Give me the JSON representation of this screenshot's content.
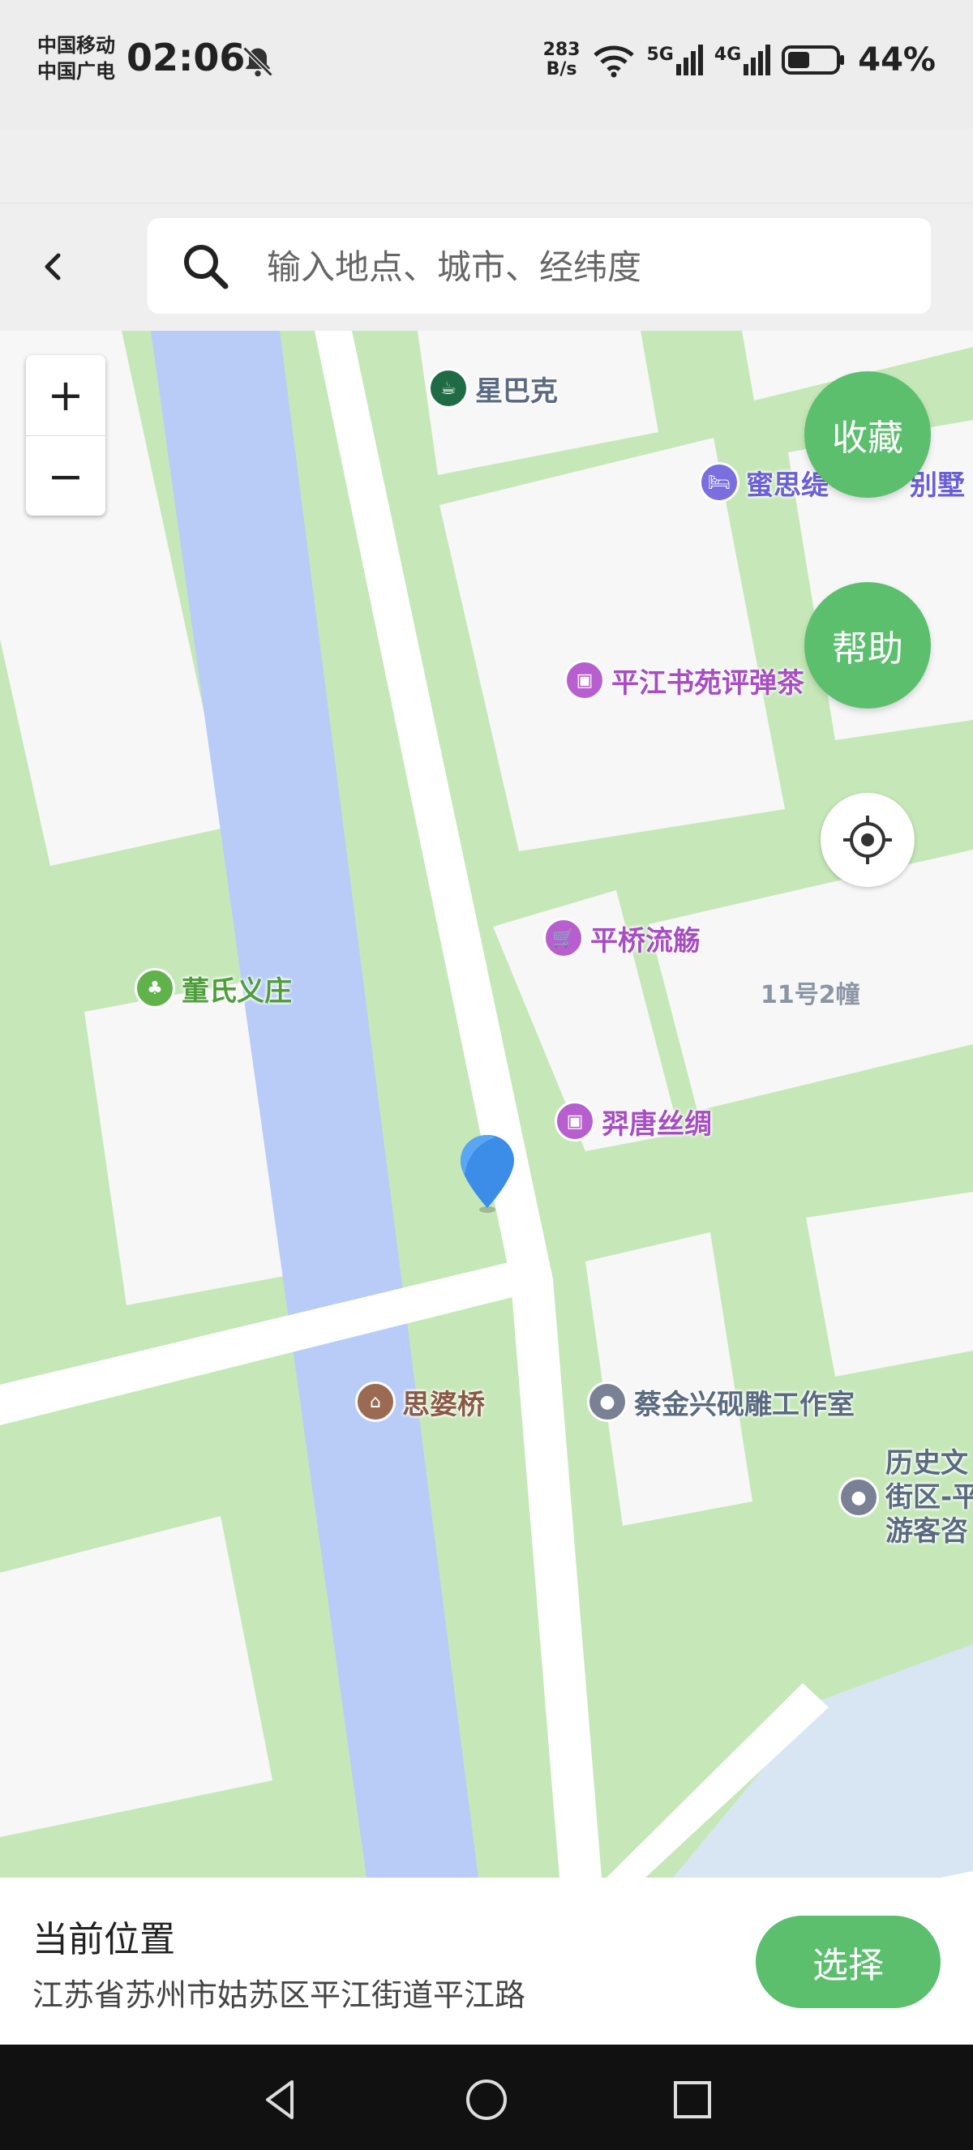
{
  "status_bar": {
    "carrier1": "中国移动",
    "carrier2": "中国广电",
    "time": "02:06",
    "speed_value": "283",
    "speed_unit": "B/s",
    "net1": "5G",
    "net2": "4G",
    "battery": "44%"
  },
  "header": {
    "search_placeholder": "输入地点、城市、经纬度"
  },
  "map": {
    "zoom_in": "+",
    "zoom_out": "−",
    "favorite_label": "收藏",
    "help_label": "帮助",
    "pois": {
      "starbucks": "星巴克",
      "villa": "蜜思缇",
      "villa_tail": "别墅",
      "pingjiang": "平江书苑评弹茶",
      "pingqiao": "平桥流觞",
      "dong": "董氏义庄",
      "building": "11号2幢",
      "yitang": "羿唐丝绸",
      "sipo": "思婆桥",
      "caijin": "蔡金兴砚雕工作室",
      "history_1": "历史文",
      "history_2": "街区-平",
      "history_3": "游客咨"
    },
    "colors": {
      "green": "#c6e8b8",
      "water": "#b8ccf7",
      "building": "#f7f7f7",
      "road": "#ffffff",
      "accent": "#5bbf6e",
      "pin": "#3b8de8"
    }
  },
  "sheet": {
    "title": "当前位置",
    "address": "江苏省苏州市姑苏区平江街道平江路",
    "select_label": "选择"
  }
}
